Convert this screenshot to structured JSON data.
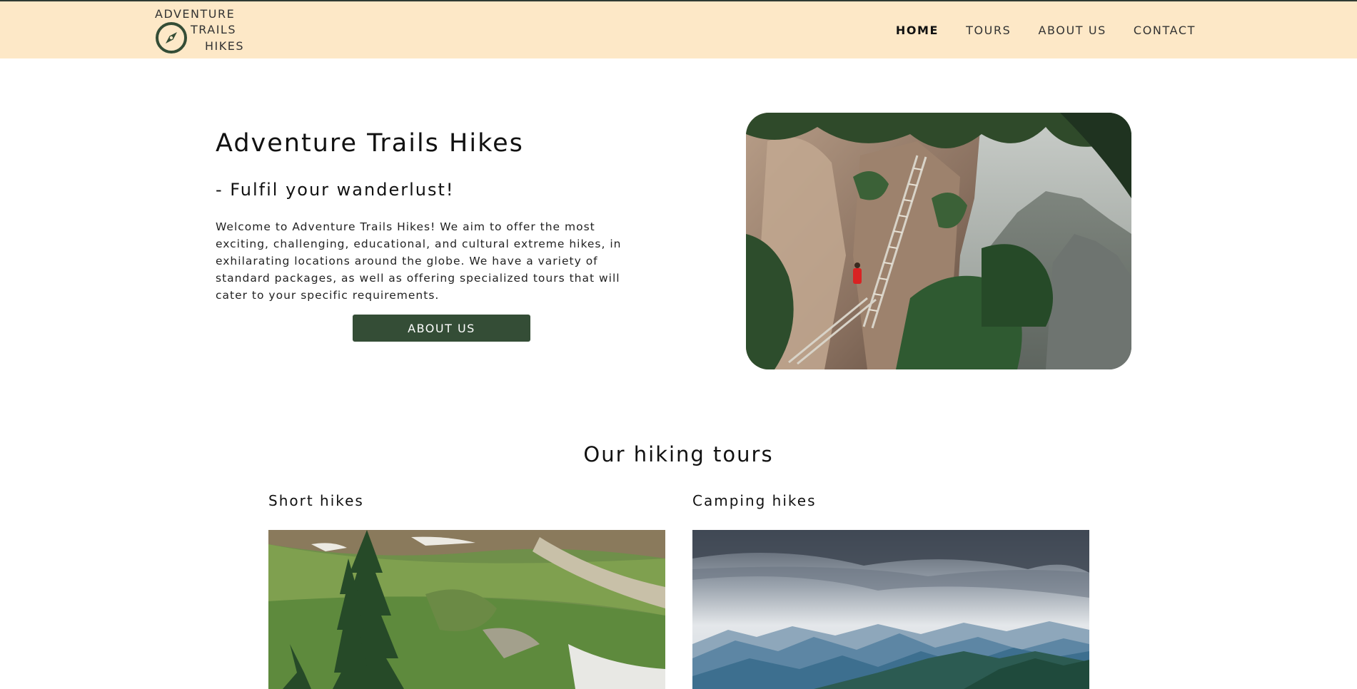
{
  "brand": {
    "line1": "ADVENTURE",
    "line2": "TRAILS",
    "line3": "HIKES",
    "icon": "compass-icon",
    "color": "#344d36"
  },
  "nav": {
    "items": [
      {
        "label": "HOME",
        "active": true
      },
      {
        "label": "TOURS",
        "active": false
      },
      {
        "label": "ABOUT US",
        "active": false
      },
      {
        "label": "CONTACT",
        "active": false
      }
    ]
  },
  "hero": {
    "title": "Adventure Trails Hikes",
    "subtitle": "- Fulfil your wanderlust!",
    "text": "Welcome to Adventure Trails Hikes! We aim to offer the most exciting, challenging, educational, and cultural extreme hikes, in exhilarating locations around the globe. We have a variety of standard packages, as well as offering specialized tours that will cater to your specific requirements.",
    "button_label": "ABOUT US",
    "image": "cliff-ladder-hiker-photo"
  },
  "tours": {
    "title": "Our hiking tours",
    "cards": [
      {
        "title": "Short hikes",
        "image": "alpine-meadow-pine-photo"
      },
      {
        "title": "Camping hikes",
        "image": "blue-mountain-range-photo"
      }
    ]
  },
  "colors": {
    "header_bg": "#fde8c7",
    "accent": "#344d36",
    "text": "#111111"
  }
}
